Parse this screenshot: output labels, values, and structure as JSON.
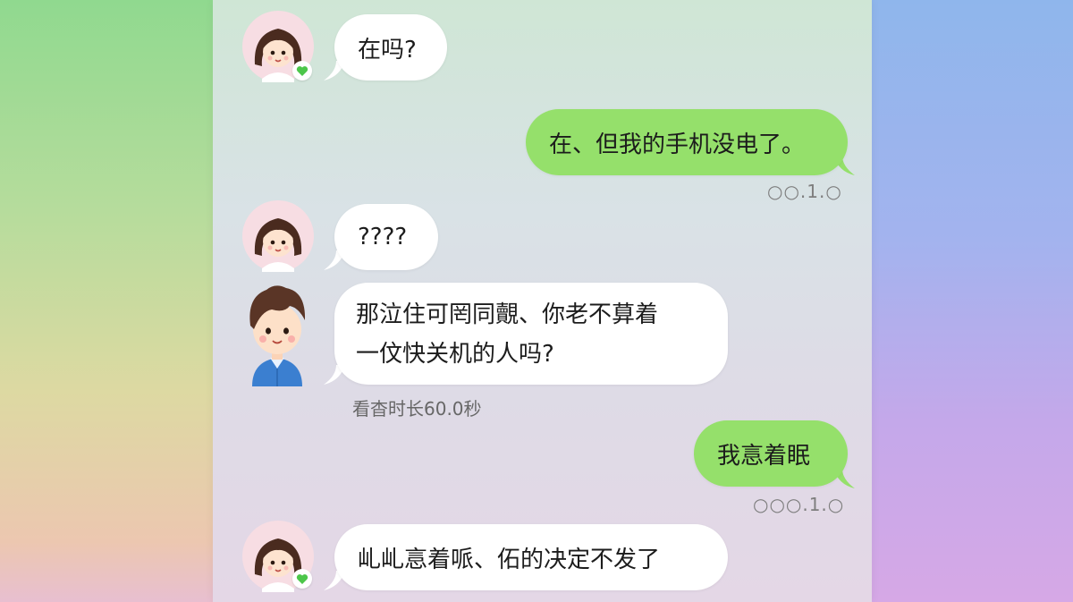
{
  "chat": {
    "messages": [
      {
        "side": "in",
        "avatar": "girl-avatar",
        "text": "在吗?"
      },
      {
        "side": "out",
        "text": "在、但我的手机没电了。",
        "meta": "○○.1.○"
      },
      {
        "side": "in",
        "avatar": "girl-avatar",
        "text": "????"
      },
      {
        "side": "in",
        "avatar": "boy-avatar",
        "line1": "那泣住可罔同覿、你老不萛着",
        "line2": "一伩快关机的人吗?",
        "meta": "看杳时长60.0秒"
      },
      {
        "side": "out",
        "text": "我悥着眠",
        "meta": "○○○.1.○"
      },
      {
        "side": "in",
        "avatar": "girl-avatar",
        "text": "乢乢悥着哌、佦的决定不发了"
      }
    ]
  },
  "colors": {
    "incoming_bubble": "#ffffff",
    "outgoing_bubble": "#95e06b",
    "online_heart": "#4cc64a"
  }
}
